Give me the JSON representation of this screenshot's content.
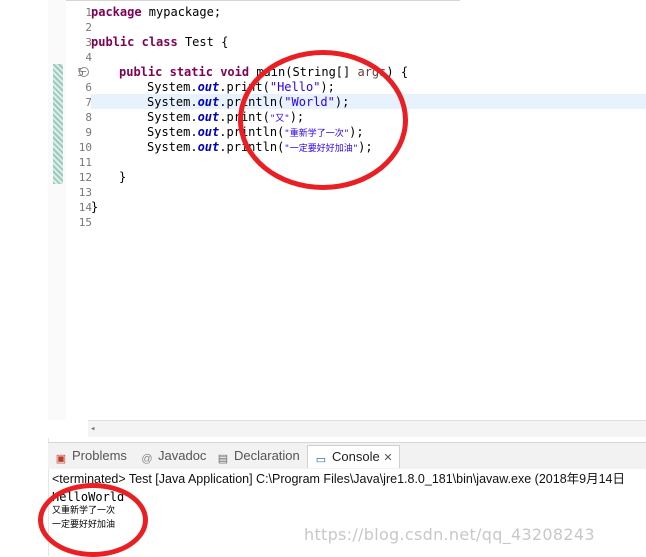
{
  "editor": {
    "line_numbers": [
      "1",
      "2",
      "3",
      "4",
      "5",
      "6",
      "7",
      "8",
      "9",
      "10",
      "11",
      "12",
      "13",
      "14",
      "15"
    ],
    "code": {
      "l1_kw": "package",
      "l1_rest": " mypackage;",
      "l3_kw1": "public",
      "l3_kw2": "class",
      "l3_rest": " Test {",
      "l5_kw1": "public",
      "l5_kw2": "static",
      "l5_kw3": "void",
      "l5_mid": " main(String[] ",
      "l5_param": "args",
      "l5_end": ") {",
      "sys": "System.",
      "out": "out",
      "l6_call": ".print(",
      "l6_str": "\"Hello\"",
      "l6_end": ");",
      "l7_call": ".println(",
      "l7_str": "\"World\"",
      "l7_end": ");",
      "l8_call": ".print(",
      "l8_str": "\"又\"",
      "l8_end": ");",
      "l9_call": ".println(",
      "l9_str": "\"重新学了一次\"",
      "l9_end": ");",
      "l10_call": ".println(",
      "l10_str": "\"一定要好好加油\"",
      "l10_end": ");",
      "l12": "}",
      "l14": "}"
    }
  },
  "panel": {
    "tabs": {
      "problems": "Problems",
      "javadoc": "Javadoc",
      "declaration": "Declaration",
      "console": "Console"
    },
    "console_status": "<terminated> Test [Java Application] C:\\Program Files\\Java\\jre1.8.0_181\\bin\\javaw.exe (2018年9月14日",
    "output": [
      "HelloWorld",
      "又重新学了一次",
      "一定要好好加油"
    ]
  },
  "watermark": "https://blog.csdn.net/qq_43208243",
  "colors": {
    "annotation": "#ea1f24",
    "keyword": "#7f0055",
    "string": "#2a00ff",
    "field": "#0000c0"
  }
}
